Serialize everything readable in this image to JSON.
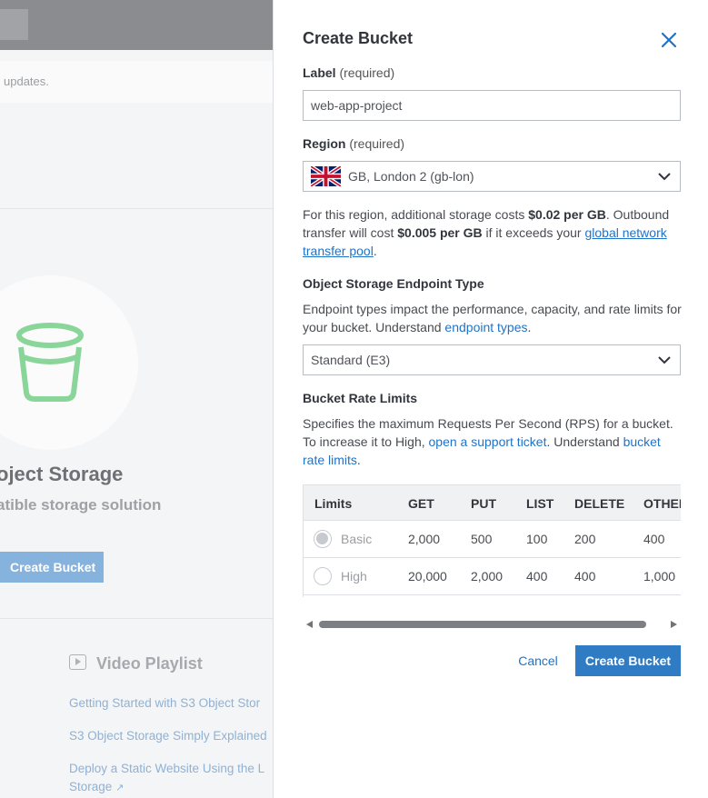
{
  "background": {
    "notice_text": "updates.",
    "title": "oject Storage",
    "subtitle": "atible storage solution",
    "create_button": "Create Bucket",
    "playlist_title": "Video Playlist",
    "playlist_links": [
      "Getting Started with S3 Object Stor",
      "S3 Object Storage Simply Explained",
      "Deploy a Static Website Using the L",
      "Storage"
    ]
  },
  "drawer": {
    "title": "Create Bucket",
    "label_field": {
      "label": "Label",
      "required": "(required)",
      "value": "web-app-project"
    },
    "region_field": {
      "label": "Region",
      "required": "(required)",
      "value": "GB, London 2 (gb-lon)",
      "flag_icon": "uk-flag-icon"
    },
    "region_note": {
      "p1": "For this region, additional storage costs ",
      "b1": "$0.02 per GB",
      "p2": ". Outbound transfer will cost ",
      "b2": "$0.005 per GB",
      "p3": " if it exceeds your ",
      "link": "global network transfer pool",
      "p4": "."
    },
    "endpoint": {
      "label": "Object Storage Endpoint Type",
      "desc": "Endpoint types impact the performance, capacity, and rate limits for your bucket. Understand ",
      "link": "endpoint types",
      "desc_end": ".",
      "value": "Standard (E3)"
    },
    "rate_limits": {
      "label": "Bucket Rate Limits",
      "desc1": "Specifies the maximum Requests Per Second (RPS) for a bucket. To increase it to High, ",
      "link1": "open a support ticket",
      "desc2": ". Understand ",
      "link2": "bucket rate limits",
      "desc3": ".",
      "columns": [
        "Limits",
        "GET",
        "PUT",
        "LIST",
        "DELETE",
        "OTHER"
      ],
      "rows": [
        {
          "name": "Basic",
          "selected": true,
          "values": [
            "2,000",
            "500",
            "100",
            "200",
            "400"
          ]
        },
        {
          "name": "High",
          "selected": false,
          "values": [
            "20,000",
            "2,000",
            "400",
            "400",
            "1,000"
          ]
        }
      ]
    },
    "cancel_label": "Cancel",
    "submit_label": "Create Bucket"
  },
  "colors": {
    "accent": "#2f7bc4",
    "link": "#1f73c8",
    "bucket_icon": "#8ad59a"
  }
}
